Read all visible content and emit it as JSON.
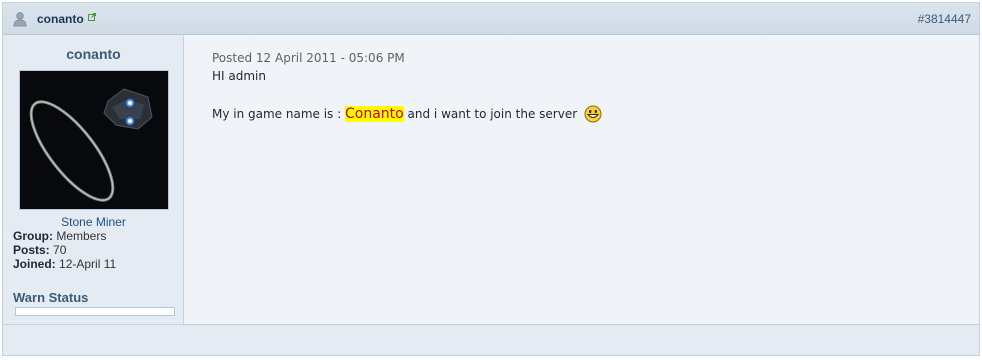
{
  "header": {
    "username": "conanto",
    "post_id": "#3814447",
    "user_icon": "user-icon",
    "external_icon": "external-link-icon"
  },
  "author": {
    "name": "conanto",
    "member_title": "Stone Miner",
    "group_label": "Group:",
    "group_value": "Members",
    "posts_label": "Posts:",
    "posts_value": "70",
    "joined_label": "Joined:",
    "joined_value": "12-April 11",
    "warn_status_label": "Warn Status"
  },
  "post": {
    "posted": "Posted 12 April 2011 - 05:06 PM",
    "line1": "HI admin",
    "line2_prefix": "My in game name is : ",
    "line2_highlight": "Conanto",
    "line2_suffix": " and i want to join the server",
    "emoticon": "smiley-icon"
  },
  "colors": {
    "header_bg": "#d5e0ea",
    "author_bg": "#e4ebf2",
    "body_bg": "#f0f4f8",
    "highlight_bg": "#ffff00",
    "highlight_text": "#d00000",
    "member_title": "#1d4f88"
  }
}
